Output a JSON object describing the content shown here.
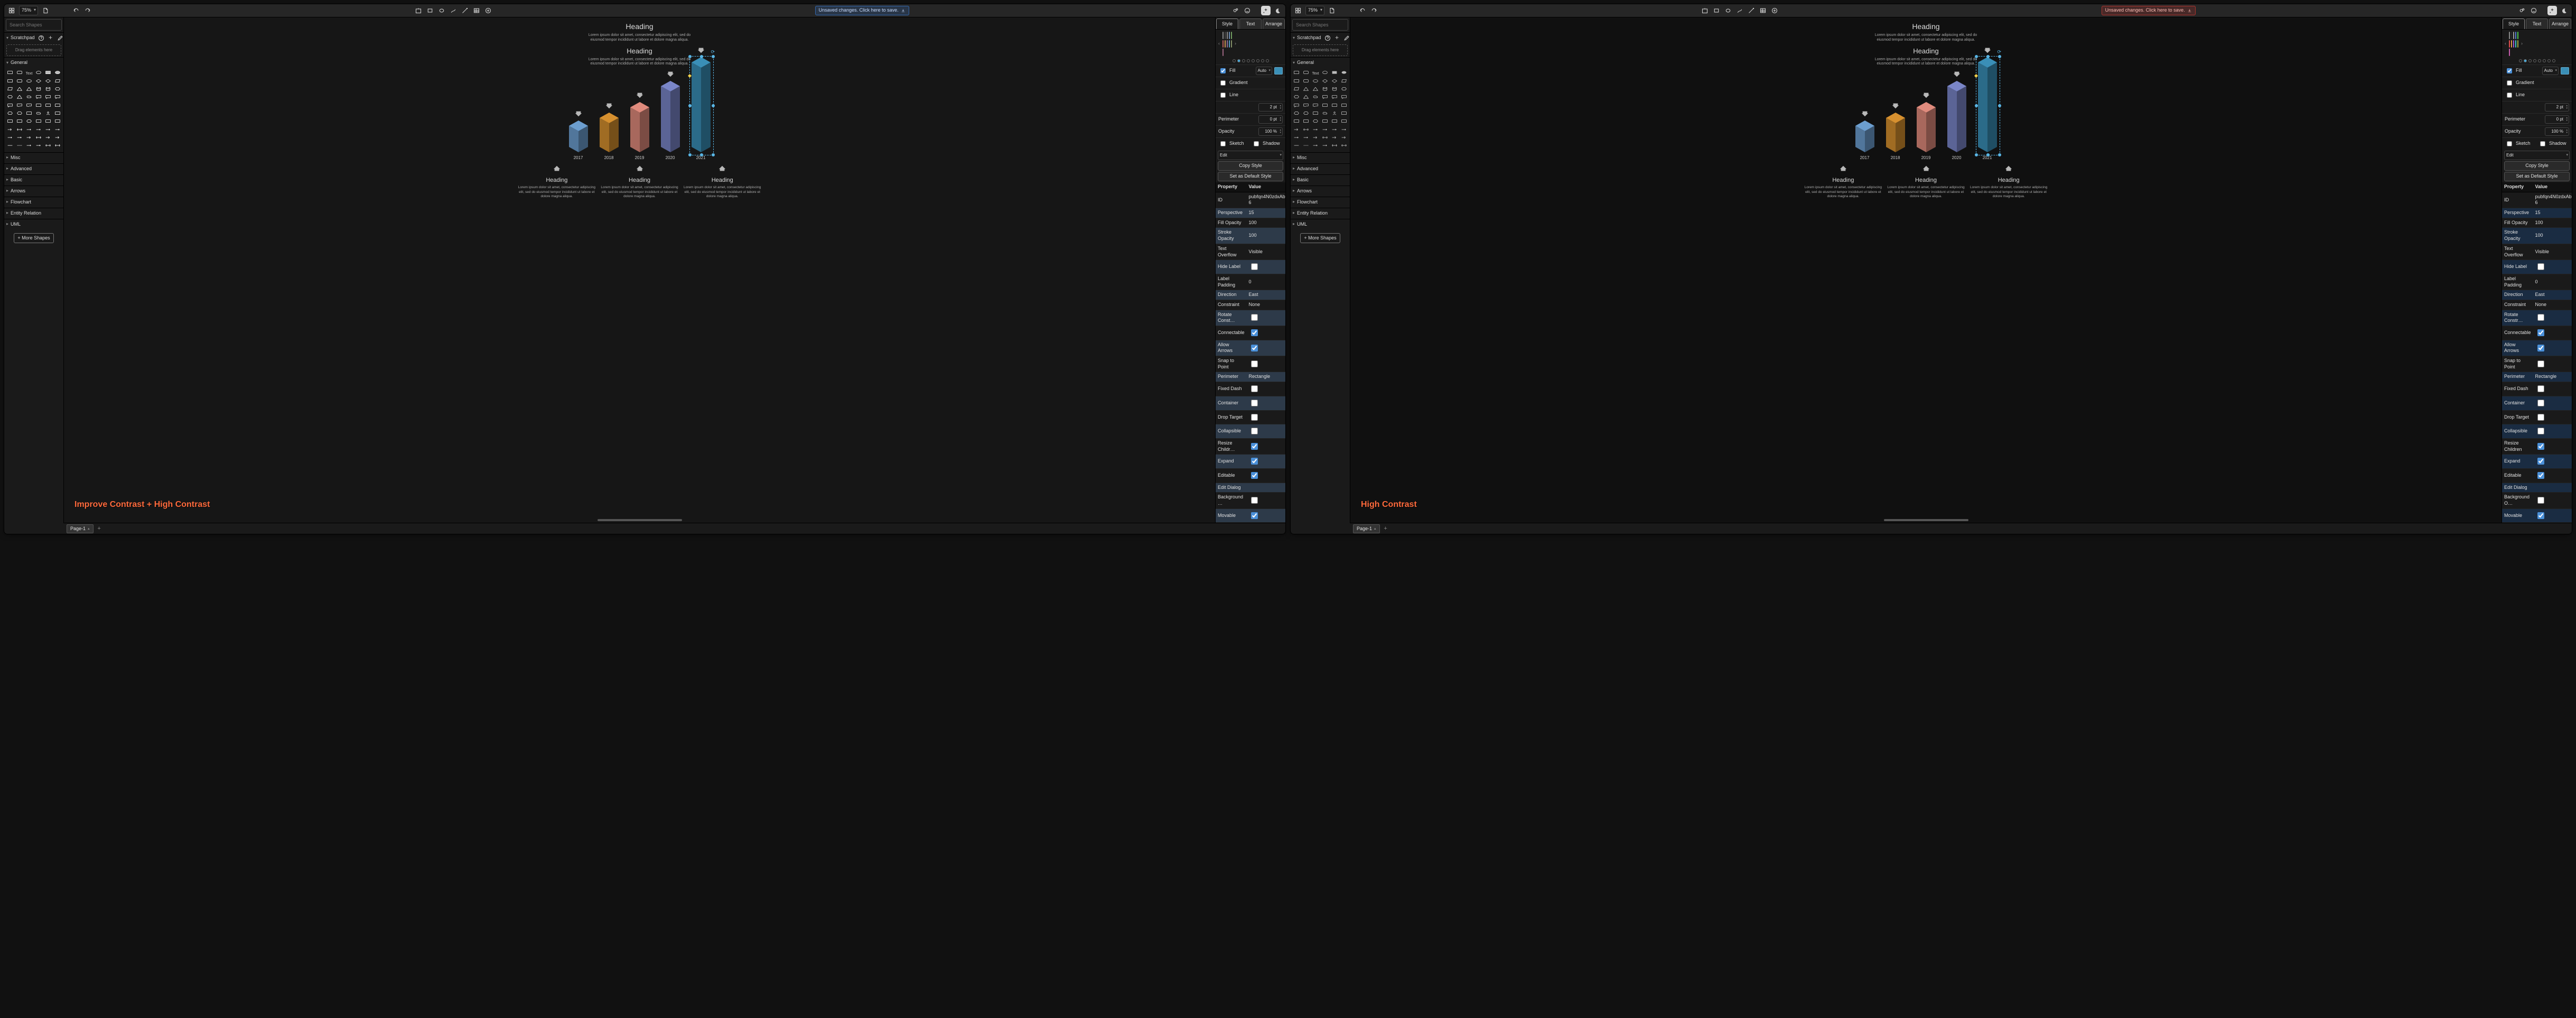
{
  "zoom": "75%",
  "search_placeholder": "Search Shapes",
  "scratchpad": {
    "title": "Scratchpad",
    "drop": "Drag elements here"
  },
  "shape_sections": [
    "General",
    "Misc",
    "Advanced",
    "Basic",
    "Arrows",
    "Flowchart",
    "Entity Relation",
    "UML"
  ],
  "more_shapes": "+ More Shapes",
  "page_tab": "Page-1",
  "save_text": "Unsaved changes. Click here to save.",
  "tabs": {
    "style": "Style",
    "text": "Text",
    "arrange": "Arrange"
  },
  "swatches_a": [
    [
      "#2b2b2b",
      "#777",
      "#5279a8",
      "#5a8c46",
      "#b04240"
    ],
    [
      "#c88a3a",
      "#7b5a8c",
      "#3a8fb7",
      "#6b7a4a",
      "#8a4a6a"
    ]
  ],
  "swatches_b": [
    [
      "#000000",
      "#888888",
      "#3a6bcf",
      "#2fbf2f",
      "#e03030"
    ],
    [
      "#d68a2a",
      "#8a3fd6",
      "#20c0c0",
      "#8aa020",
      "#c040a0"
    ]
  ],
  "fill": {
    "label": "Fill",
    "auto": "Auto",
    "color": "#3a8fb7"
  },
  "gradient": "Gradient",
  "line": "Line",
  "perimeter_l": "Perimeter",
  "line_pt": "2 pt",
  "perim_pt": "0 pt",
  "opacity": "Opacity",
  "op_pct": "100 %",
  "sketch": "Sketch",
  "shadow": "Shadow",
  "edit": "Edit",
  "copy_style": "Copy Style",
  "set_default": "Set as Default Style",
  "prop_header": {
    "k": "Property",
    "v": "Value"
  },
  "props": [
    {
      "k": "ID",
      "v": "pubfqn4N0zdxAbnbV6L2-6"
    },
    {
      "k": "Perspective",
      "v": "15"
    },
    {
      "k": "Fill Opacity",
      "v": "100"
    },
    {
      "k": "Stroke Opacity",
      "v": "100"
    },
    {
      "k": "Text Overflow",
      "v": "Visible"
    },
    {
      "k": "Hide Label",
      "v": false
    },
    {
      "k": "Label Padding",
      "v": "0"
    },
    {
      "k": "Direction",
      "v": "East"
    },
    {
      "k": "Constraint",
      "v": "None"
    },
    {
      "k": "Rotate Const…",
      "v": false
    },
    {
      "k": "Connectable",
      "v": true
    },
    {
      "k": "Allow Arrows",
      "v": true
    },
    {
      "k": "Snap to Point",
      "v": false
    },
    {
      "k": "Perimeter",
      "v": "Rectangle"
    },
    {
      "k": "Fixed Dash",
      "v": false
    },
    {
      "k": "Container",
      "v": false
    },
    {
      "k": "Drop Target",
      "v": false
    },
    {
      "k": "Collapsible",
      "v": false
    },
    {
      "k": "Resize Childr…",
      "v": true
    },
    {
      "k": "Expand",
      "v": true
    },
    {
      "k": "Editable",
      "v": true
    },
    {
      "k": "Edit Dialog",
      "v": ""
    },
    {
      "k": "Background …",
      "v": false
    },
    {
      "k": "Movable",
      "v": true
    }
  ],
  "props_b": [
    {
      "k": "ID",
      "v": "pubfqn4N0zdxAbnbV6L2-6"
    },
    {
      "k": "Perspective",
      "v": "15"
    },
    {
      "k": "Fill Opacity",
      "v": "100"
    },
    {
      "k": "Stroke Opacity",
      "v": "100"
    },
    {
      "k": "Text Overflow",
      "v": "Visible"
    },
    {
      "k": "Hide Label",
      "v": false
    },
    {
      "k": "Label Padding",
      "v": "0"
    },
    {
      "k": "Direction",
      "v": "East"
    },
    {
      "k": "Constraint",
      "v": "None"
    },
    {
      "k": "Rotate Constr…",
      "v": false
    },
    {
      "k": "Connectable",
      "v": true
    },
    {
      "k": "Allow Arrows",
      "v": true
    },
    {
      "k": "Snap to Point",
      "v": false
    },
    {
      "k": "Perimeter",
      "v": "Rectangle"
    },
    {
      "k": "Fixed Dash",
      "v": false
    },
    {
      "k": "Container",
      "v": false
    },
    {
      "k": "Drop Target",
      "v": false
    },
    {
      "k": "Collapsible",
      "v": false
    },
    {
      "k": "Resize Children",
      "v": true
    },
    {
      "k": "Expand",
      "v": true
    },
    {
      "k": "Editable",
      "v": true
    },
    {
      "k": "Edit Dialog",
      "v": ""
    },
    {
      "k": "Background O…",
      "v": false
    },
    {
      "k": "Movable",
      "v": true
    }
  ],
  "doc": {
    "h1": "Heading",
    "lorem": "Lorem ipsum dolor sit amet, consectetur adipiscing elit, sed do eiusmod tempor incididunt ut labore et dolore magna aliqua.",
    "h2": "Heading",
    "trio": "Heading"
  },
  "chart_data": {
    "type": "bar",
    "categories": [
      "2017",
      "2018",
      "2019",
      "2020",
      "2021"
    ],
    "values": [
      40,
      55,
      75,
      115,
      160
    ],
    "colors": [
      "#6c9ecf",
      "#d6902f",
      "#e08b7d",
      "#7a86c8",
      "#3a8fb7"
    ],
    "title": "Heading",
    "xlabel": "",
    "ylabel": "",
    "ylim": [
      0,
      170
    ]
  },
  "overlay_a": "Improve Contrast + High Contrast",
  "overlay_b": "High Contrast"
}
